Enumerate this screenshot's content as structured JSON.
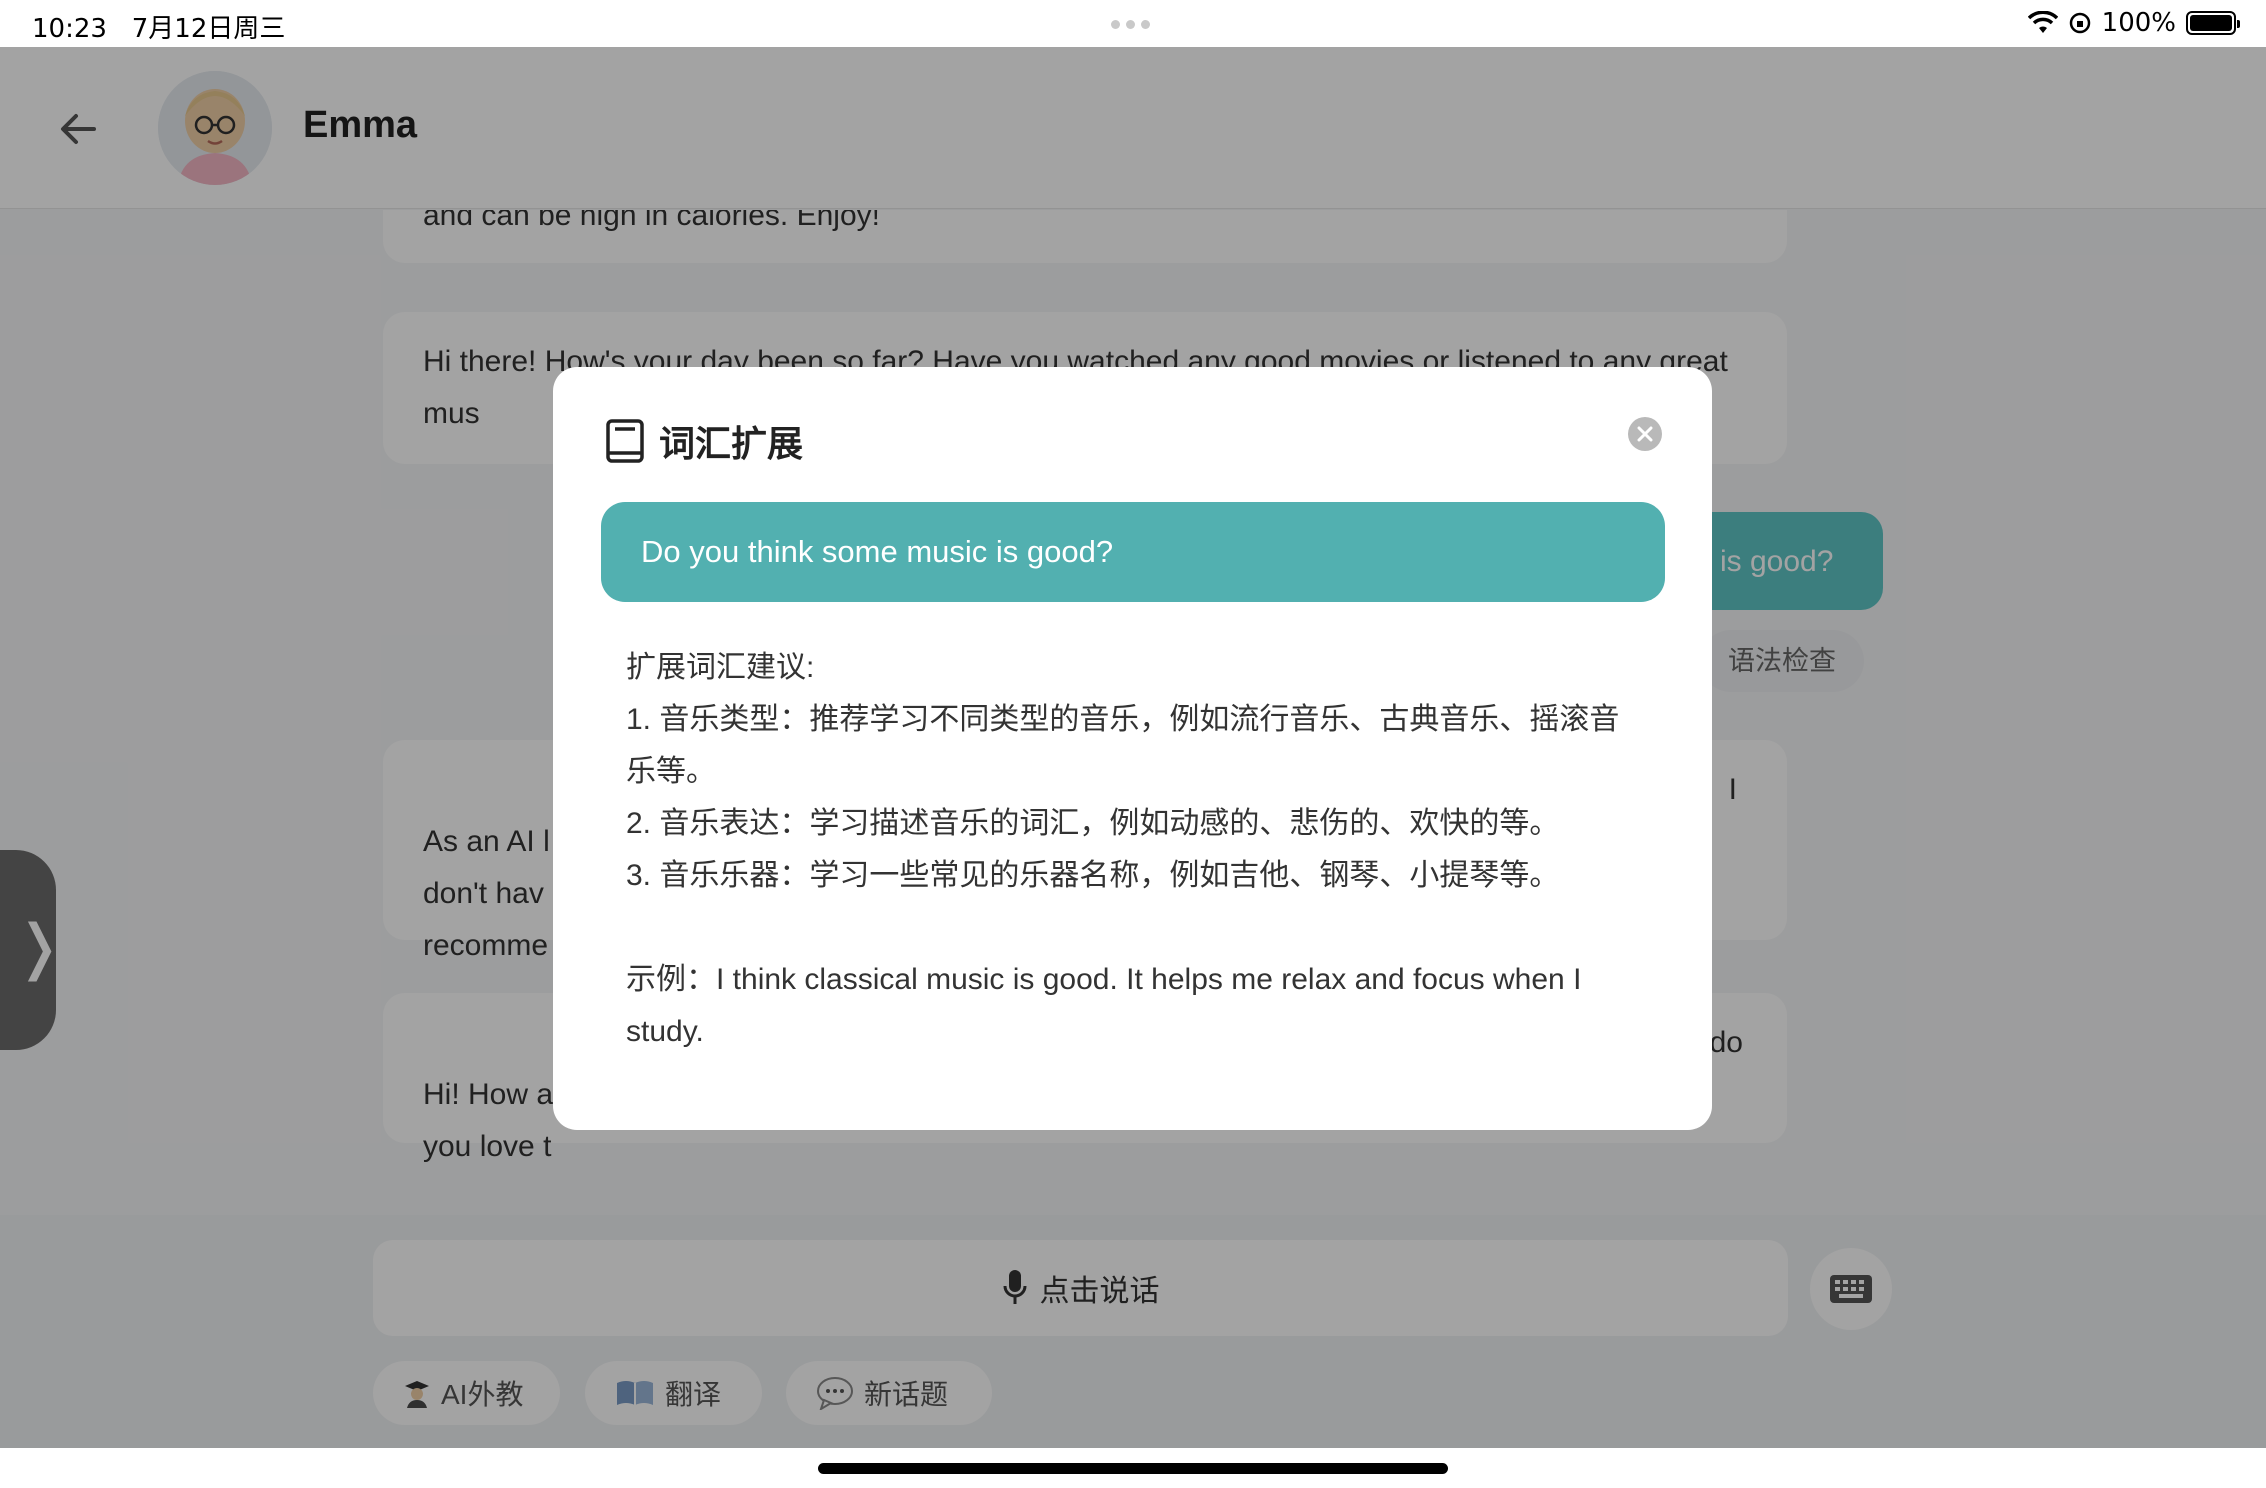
{
  "status_bar": {
    "time": "10:23",
    "date": "7月12日周三",
    "battery": "100%",
    "battery_level": 1.0
  },
  "header": {
    "name": "Emma",
    "back_icon": "arrow-left-icon"
  },
  "chat": {
    "messages": [
      {
        "role": "ai",
        "text": "and can be high in calories. Enjoy!"
      },
      {
        "role": "ai",
        "text": "Hi there! How's your day been so far? Have you watched any good movies or listened to any great mus"
      },
      {
        "role": "user",
        "text": "is good?"
      },
      {
        "role": "ai",
        "text_left": "As an AI l\ndon't hav\nrecomme",
        "text_right": "I"
      },
      {
        "role": "ai",
        "text_left": "Hi! How a\nyou love t",
        "text_right": "do"
      }
    ],
    "grammar_chip": "语法检查",
    "side_tab_icon": "chevron-right-icon",
    "side_tab_glyph": "❭"
  },
  "bottom": {
    "talk_label": "点击说话",
    "mic_icon": "microphone-icon",
    "keyboard_icon": "keyboard-icon",
    "pills": [
      {
        "icon": "teacher-icon",
        "label": "AI外教"
      },
      {
        "icon": "book-icon",
        "label": "翻译"
      },
      {
        "icon": "speech-bubble-icon",
        "label": "新话题"
      }
    ]
  },
  "modal": {
    "title": "词汇扩展",
    "title_icon": "notebook-icon",
    "close_icon": "close-circle-icon",
    "sentence": "Do you think some music is good?",
    "body_lines": [
      "扩展词汇建议:",
      "1. 音乐类型：推荐学习不同类型的音乐，例如流行音乐、古典音乐、摇滚音乐等。",
      "2. 音乐表达：学习描述音乐的词汇，例如动感的、悲伤的、欢快的等。",
      "3. 音乐乐器：学习一些常见的乐器名称，例如吉他、钢琴、小提琴等。",
      "",
      "示例：I think classical music is good. It helps me relax and focus when I study."
    ]
  },
  "colors": {
    "accent": "#52b0b0",
    "user_bubble": "#5ec6c6",
    "overlay": "rgba(0,0,0,0.36)"
  }
}
